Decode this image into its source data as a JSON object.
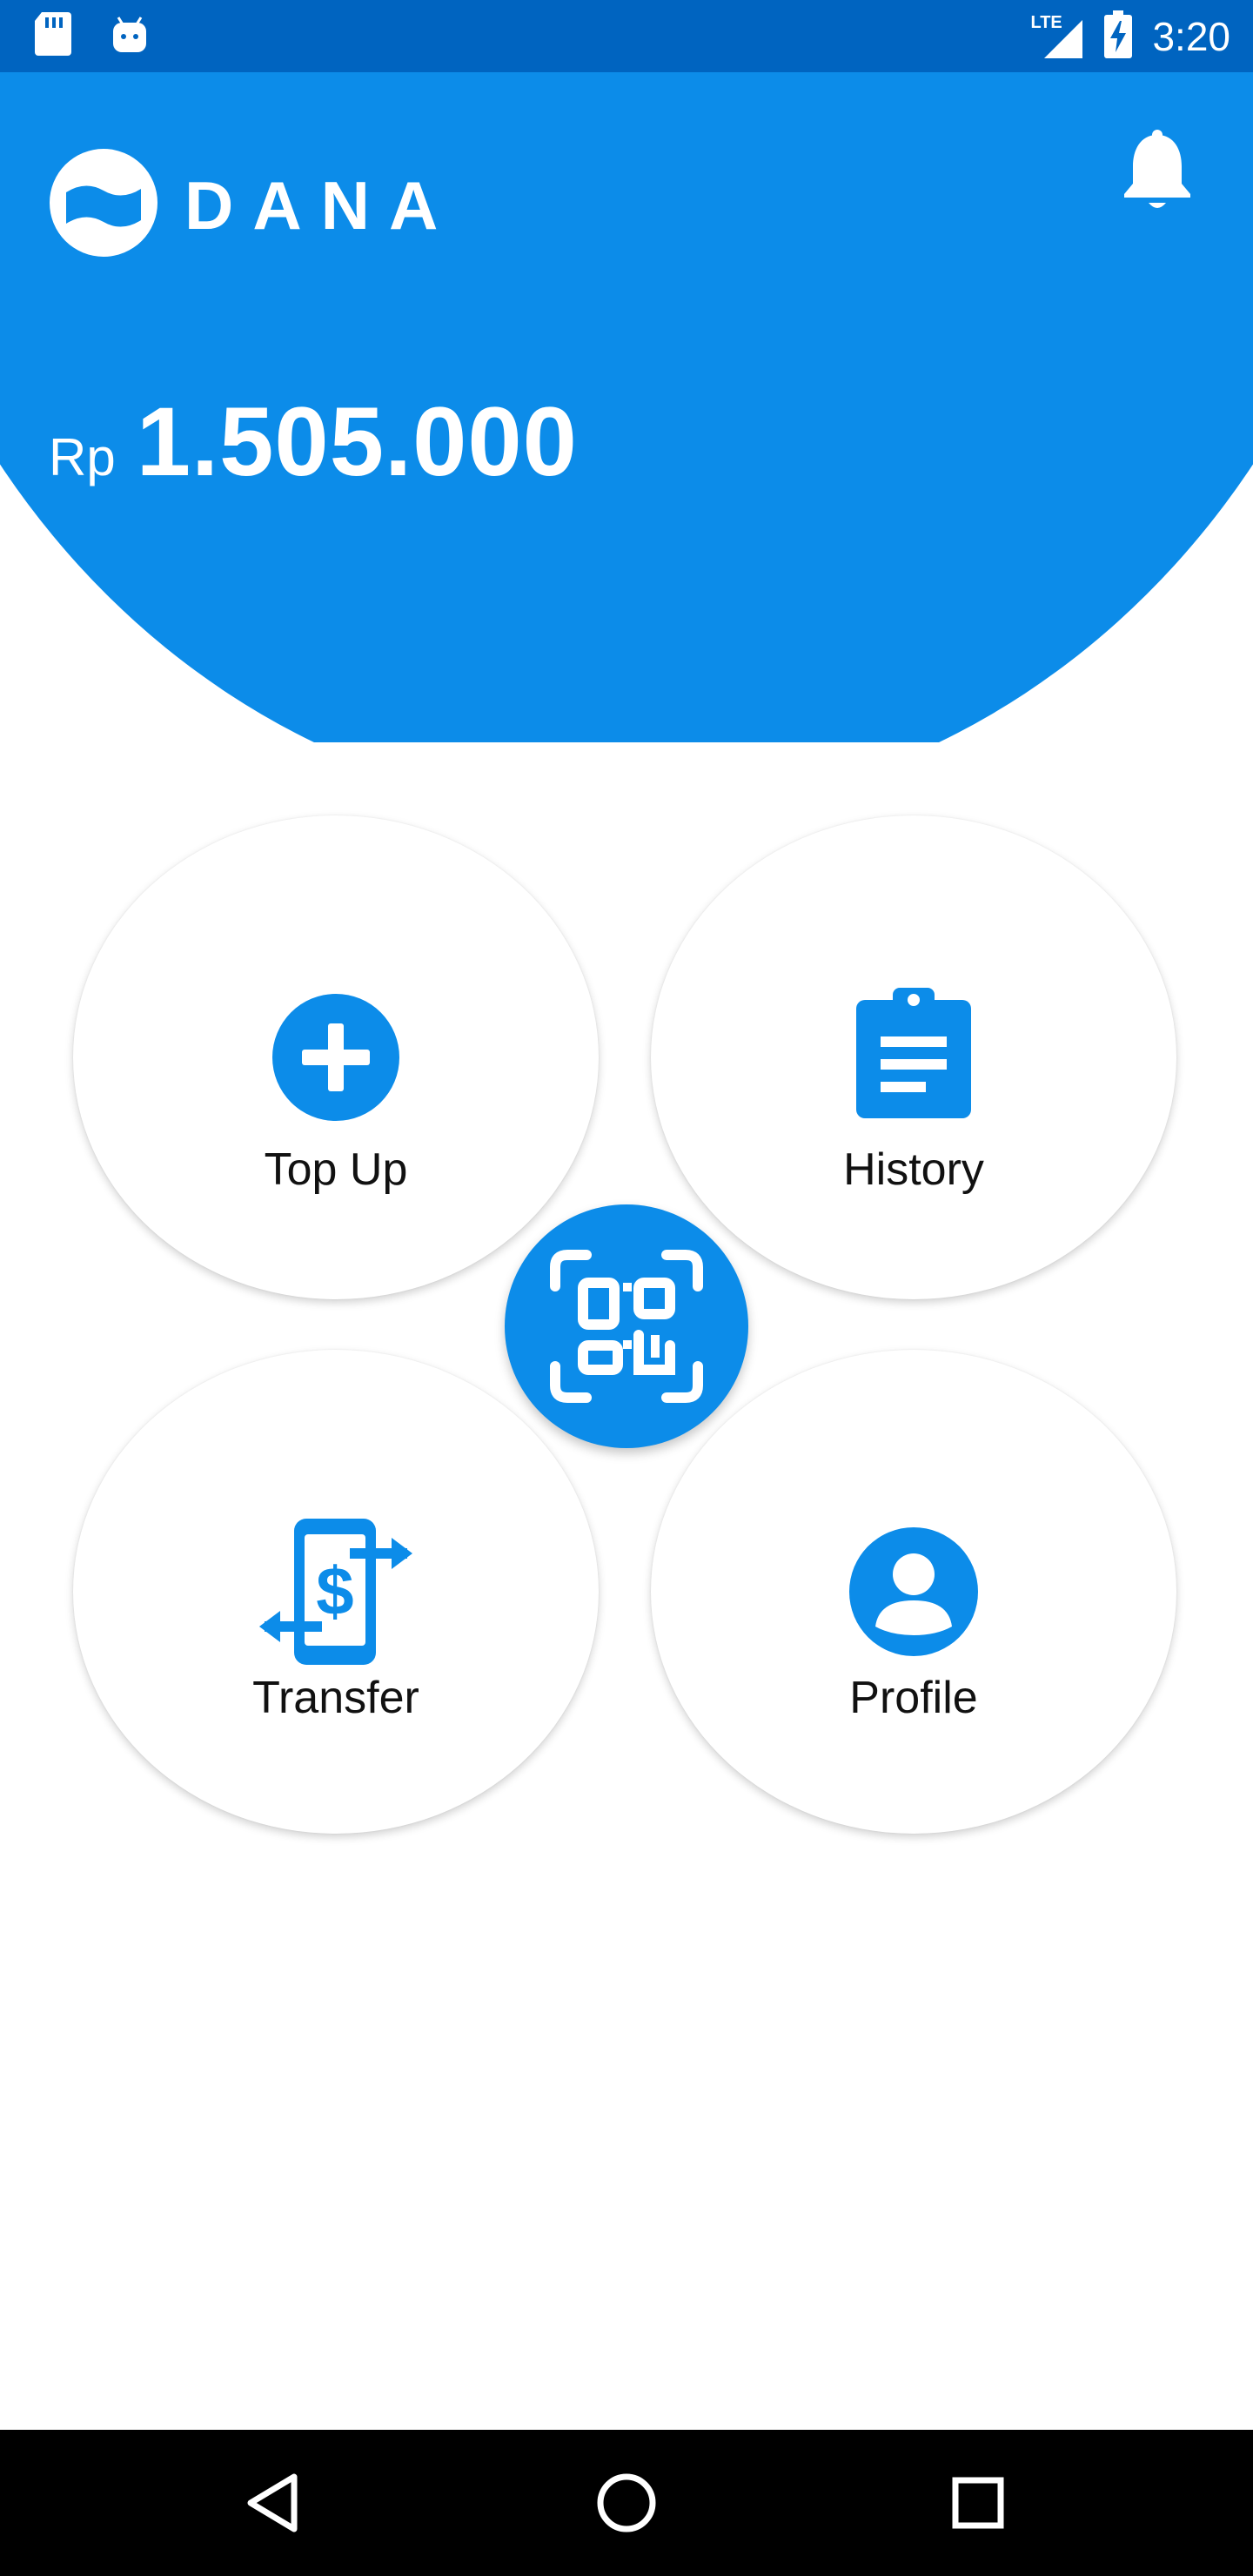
{
  "status_bar": {
    "time": "3:20",
    "network_label": "LTE",
    "icons": [
      "sd-card-icon",
      "android-icon",
      "signal-icon",
      "battery-charging-icon"
    ]
  },
  "header": {
    "brand": "DANA",
    "notification_icon": "bell-icon",
    "balance": {
      "currency": "Rp",
      "amount": "1.505.000"
    }
  },
  "menu": {
    "items": [
      {
        "label": "Top Up",
        "icon": "plus-circle-icon"
      },
      {
        "label": "History",
        "icon": "clipboard-icon"
      },
      {
        "label": "Transfer",
        "icon": "transfer-money-icon"
      },
      {
        "label": "Profile",
        "icon": "profile-icon"
      }
    ],
    "center_button_icon": "qr-scan-icon"
  },
  "nav_bar": {
    "buttons": [
      "back-icon",
      "home-icon",
      "recents-icon"
    ]
  },
  "colors": {
    "status_bar": "#0064c0",
    "primary": "#0c8ce9",
    "card": "#ffffff",
    "text": "#111111",
    "nav_bar": "#000000"
  }
}
